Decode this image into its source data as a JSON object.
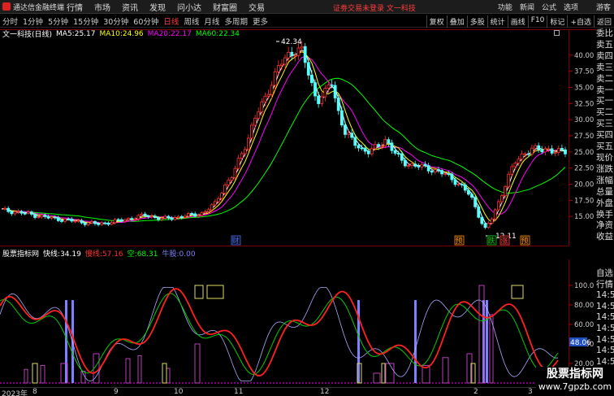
{
  "app": {
    "name": "通达信金融终端",
    "menu": [
      "行情",
      "市场",
      "资讯",
      "发现",
      "问小达",
      "财富圈",
      "交易"
    ],
    "notice": "证劵交易未登录 文一科技",
    "right_menu": [
      "功能",
      "新闻",
      "公式",
      "选项"
    ],
    "guest": "游客"
  },
  "toolbar": {
    "periods": [
      "分时",
      "1分钟",
      "5分钟",
      "15分钟",
      "30分钟",
      "60分钟",
      "日线",
      "周线",
      "月线",
      "多周期",
      "更多"
    ],
    "active": "日线",
    "right": [
      "复权",
      "叠加",
      "多股",
      "统计",
      "画线",
      "F10",
      "标记",
      "+自选",
      "返回"
    ]
  },
  "stock": {
    "name": "文一科技(日线)",
    "ma": [
      {
        "label": "MA5:",
        "value": "25.17",
        "color": "#ffffff"
      },
      {
        "label": "MA10:",
        "value": "24.96",
        "color": "#ffff00"
      },
      {
        "label": "MA20:",
        "value": "22.17",
        "color": "#ff00ff"
      },
      {
        "label": "MA60:",
        "value": "22.34",
        "color": "#00ff00"
      }
    ]
  },
  "price_axis": {
    "ticks": [
      "40.00",
      "37.50",
      "35.00",
      "32.50",
      "30.00",
      "27.50",
      "25.00",
      "22.50",
      "20.00",
      "17.50",
      "15.00"
    ],
    "high_label": "42.34",
    "low_label": "12.11"
  },
  "event_badges": [
    {
      "text": "财",
      "color": "#4466ff"
    },
    {
      "text": "预",
      "color": "#ff8800"
    },
    {
      "text": "跌",
      "color": "#00bb00"
    },
    {
      "text": "涨",
      "color": "#ff3333"
    },
    {
      "text": "预",
      "color": "#ff8800"
    }
  ],
  "right_panel": [
    "委比",
    "卖五",
    "卖四",
    "卖三",
    "卖二",
    "卖一",
    "买一",
    "买二",
    "买三",
    "买四",
    "买五",
    "现价",
    "涨跌",
    "涨幅",
    "总量",
    "外盘",
    "换手",
    "净资",
    "收益"
  ],
  "right_panel2": [
    "自选",
    "行情",
    "14:56",
    "14:56",
    "14:56",
    "14:56",
    "14:56",
    "14:56",
    "14:56",
    "14:56",
    "14:56",
    "14:56"
  ],
  "indicator": {
    "name": "股票指标网",
    "items": [
      {
        "label": "快线:",
        "value": "34.19",
        "color": "#ffffff"
      },
      {
        "label": "慢线:",
        "value": "57.16",
        "color": "#ff3333"
      },
      {
        "label": "空:",
        "value": "68.31",
        "color": "#00ff00"
      },
      {
        "label": "牛股:",
        "value": "0.00",
        "color": "#8080ff"
      }
    ],
    "ticks": [
      "100.0",
      "80.00",
      "60.00",
      "40.00",
      "20.00"
    ],
    "current": "48.06"
  },
  "x_axis": {
    "labels": [
      "2023年",
      "8",
      "9",
      "10",
      "11",
      "12",
      "2",
      "3"
    ]
  },
  "watermark": {
    "title": "股票指标网",
    "url": "www.7gpzb.com"
  }
}
